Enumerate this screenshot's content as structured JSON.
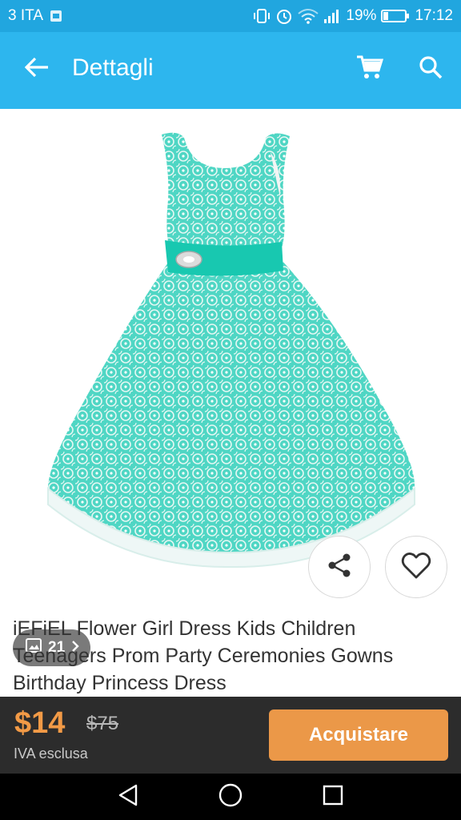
{
  "status_bar": {
    "carrier": "3 ITA",
    "battery": "19%",
    "time": "17:12",
    "icons": [
      "sim-icon",
      "vibrate-icon",
      "alarm-icon",
      "wifi-icon",
      "signal-icon",
      "battery-icon"
    ]
  },
  "app_bar": {
    "title": "Dettagli",
    "icons": [
      "back-arrow-icon",
      "cart-icon",
      "search-icon"
    ]
  },
  "gallery": {
    "photo_count": "21",
    "icons": [
      "image-icon",
      "chevron-right-icon",
      "share-icon",
      "heart-icon"
    ]
  },
  "product": {
    "title": "iEFiEL Flower Girl Dress Kids Children Teenagers Prom Party Ceremonies Gowns Birthday Princess Dress"
  },
  "purchase": {
    "price": "$14",
    "old_price": "$75",
    "vat_note": "IVA esclusa",
    "buy_label": "Acquistare"
  },
  "nav_bar": {
    "icons": [
      "back-triangle-icon",
      "home-circle-icon",
      "recents-square-icon"
    ]
  },
  "colors": {
    "status_bar": "#21a6df",
    "app_bar": "#2db6ee",
    "dress": "#4fd6c4",
    "price": "#f29a46",
    "buy_button": "#eb9848",
    "price_bar": "#2c2c2c"
  }
}
